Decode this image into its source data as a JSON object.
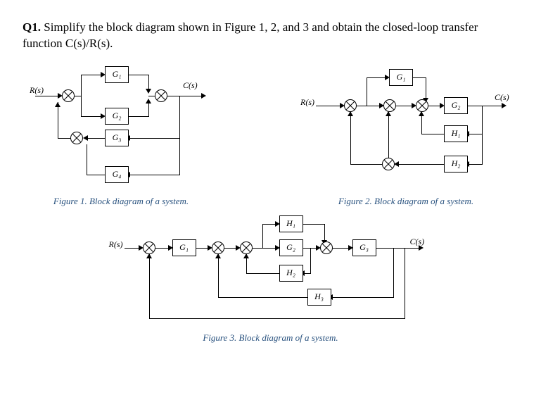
{
  "question": {
    "number": "Q1.",
    "text": "Simplify the block diagram shown in Figure 1, 2, and 3 and obtain the closed-loop transfer function C(s)/R(s)."
  },
  "figure1": {
    "caption": "Figure  1. Block diagram of a system.",
    "input_label": "R(s)",
    "output_label": "C(s)",
    "blocks": {
      "g1": "G₁",
      "g2": "G₂",
      "g3": "G₃",
      "g4": "G₄"
    }
  },
  "figure2": {
    "caption": "Figure  2. Block diagram of a system.",
    "input_label": "R(s)",
    "output_label": "C(s)",
    "blocks": {
      "g1": "G₁",
      "g2": "G₂",
      "h1": "H₁",
      "h2": "H₂"
    }
  },
  "figure3": {
    "caption": "Figure  3. Block diagram of a system.",
    "input_label": "R(s)",
    "output_label": "C(s)",
    "blocks": {
      "g1": "G₁",
      "g2": "G₂",
      "g3": "G₃",
      "h1": "H₁",
      "h2": "H₂",
      "h3": "H₃"
    }
  },
  "chart_data": [
    {
      "type": "block-diagram",
      "figure": 1,
      "input": "R(s)",
      "output": "C(s)",
      "summing_junctions": [
        "S1",
        "S2",
        "S3"
      ],
      "blocks": [
        "G1",
        "G2",
        "G3",
        "G4"
      ],
      "connections": [
        {
          "from": "R(s)",
          "to": "S1"
        },
        {
          "from": "S1",
          "to": "G1",
          "path": "upper-forward"
        },
        {
          "from": "S1",
          "to": "G2",
          "path": "lower-forward"
        },
        {
          "from": "G1",
          "to": "S2",
          "sign": "+"
        },
        {
          "from": "G2",
          "to": "S2",
          "sign": "+"
        },
        {
          "from": "S2",
          "to": "C(s)"
        },
        {
          "from": "C(s)",
          "to": "G3",
          "path": "feedback"
        },
        {
          "from": "G3",
          "to": "S3",
          "sign": "+"
        },
        {
          "from": "C(s)",
          "to": "G4",
          "path": "feedback"
        },
        {
          "from": "G4",
          "to": "S3",
          "sign": "+"
        },
        {
          "from": "S3",
          "to": "S1",
          "path": "feedback"
        }
      ]
    },
    {
      "type": "block-diagram",
      "figure": 2,
      "input": "R(s)",
      "output": "C(s)",
      "summing_junctions": [
        "S1",
        "S2",
        "S3"
      ],
      "blocks": [
        "G1",
        "G2",
        "H1",
        "H2"
      ],
      "connections": [
        {
          "from": "R(s)",
          "to": "S1"
        },
        {
          "from": "S1",
          "to": "G1",
          "path": "feedforward-upper"
        },
        {
          "from": "G1",
          "to": "S2",
          "sign": "+"
        },
        {
          "from": "S1",
          "to": "S2",
          "sign": "+",
          "path": "direct"
        },
        {
          "from": "S2",
          "to": "G2"
        },
        {
          "from": "G2",
          "to": "C(s)"
        },
        {
          "from": "C(s)",
          "to": "H1",
          "path": "feedback"
        },
        {
          "from": "H1",
          "to": "S2",
          "sign": "-"
        },
        {
          "from": "C(s)",
          "to": "H2",
          "path": "feedback"
        },
        {
          "from": "H2",
          "to": "S3"
        },
        {
          "from": "S3",
          "to": "S1",
          "sign": "-",
          "path": "feedback"
        }
      ]
    },
    {
      "type": "block-diagram",
      "figure": 3,
      "input": "R(s)",
      "output": "C(s)",
      "summing_junctions": [
        "S1",
        "S2",
        "S3",
        "S4"
      ],
      "blocks": [
        "G1",
        "G2",
        "G3",
        "H1",
        "H2",
        "H3"
      ],
      "connections": [
        {
          "from": "R(s)",
          "to": "S1"
        },
        {
          "from": "S1",
          "to": "G1"
        },
        {
          "from": "G1",
          "to": "S2"
        },
        {
          "from": "S2",
          "to": "S3"
        },
        {
          "from": "S3",
          "to": "G2"
        },
        {
          "from": "S3",
          "to": "H1",
          "path": "parallel-upper"
        },
        {
          "from": "H1",
          "to": "S4",
          "sign": "+"
        },
        {
          "from": "G2",
          "to": "S4",
          "sign": "+"
        },
        {
          "from": "G2-out",
          "to": "H2",
          "path": "feedback"
        },
        {
          "from": "H2",
          "to": "S3",
          "sign": "-"
        },
        {
          "from": "S4",
          "to": "G3"
        },
        {
          "from": "G3",
          "to": "C(s)"
        },
        {
          "from": "C(s)",
          "to": "H3",
          "path": "feedback"
        },
        {
          "from": "H3",
          "to": "S2",
          "sign": "-"
        },
        {
          "from": "C(s)",
          "to": "S1",
          "sign": "-",
          "path": "outer-feedback"
        }
      ]
    }
  ]
}
